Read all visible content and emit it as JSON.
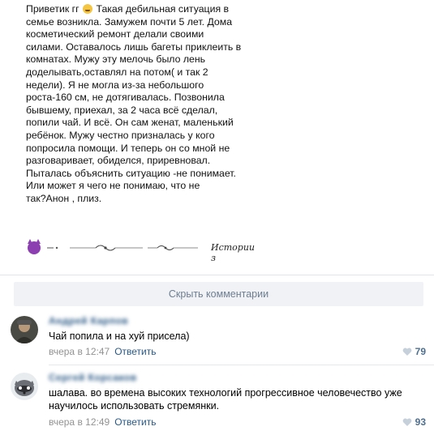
{
  "post": {
    "text_before_emoji": "Приветик гг ",
    "text_after_emoji": " Такая дебильная ситуация в\nсемье возникла. Замужем почти 5 лет. Дома\nкосметический ремонт делали своими\nсилами. Оставалось лишь багеты приклеить в\nкомнатах. Мужу эту мелочь было лень\nдоделывать,оставлял на потом( и так 2\nнедели). Я не могла из-за небольшого\nроста-160 см, не дотягивалась. Позвонила\nбывшему, приехал, за 2 часа всё сделал,\nпопили чай. И всё. Он сам женат, маленький\nребёнок. Мужу честно призналась у кого\nпопросила помощи. И теперь он со мной не\nразговаривает, обиделся, приревновал.\nПыталась объяснить ситуацию -не понимает.\nИли может я чего не понимаю, что не\nтак?Анон , плиз.",
    "signature": "Истории з"
  },
  "hide_comments_label": "Скрыть комментарии",
  "comments": [
    {
      "author": "Андрей Карпов",
      "text": "Чай попила и на хуй присела)",
      "time": "вчера в 12:47",
      "reply": "Ответить",
      "likes": "79"
    },
    {
      "author": "Сергей Корсаков",
      "text": "шалава. во времена высоких технологий прогрессивное человечество уже\nнаучилось использовать стремянки.",
      "time": "вчера в 12:49",
      "reply": "Ответить",
      "likes": "93"
    }
  ],
  "icons": {
    "heart": "heart-icon",
    "devil": "devil-icon",
    "emoji": "grin-emoji-icon"
  },
  "colors": {
    "link": "#2a5885",
    "meta": "#939393",
    "button_bg": "#f0f2f5",
    "button_text": "#6e7e91"
  }
}
